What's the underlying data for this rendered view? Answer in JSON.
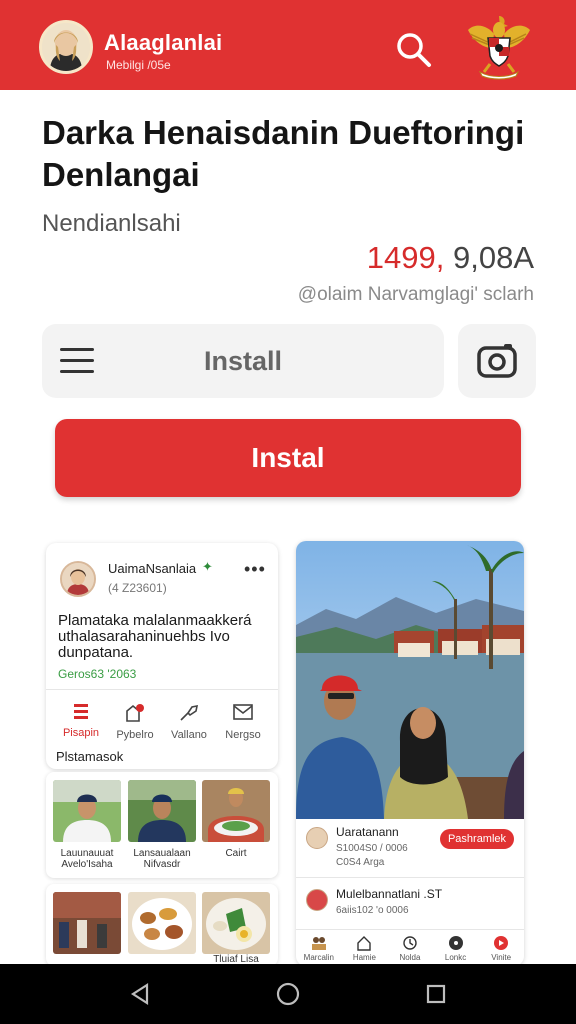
{
  "appbar": {
    "title": "Alaaglanlai",
    "subtitle": "Mebilgi /05e",
    "avatar_icon": "profile-avatar",
    "search_icon": "search-icon",
    "emblem_icon": "garuda-emblem",
    "color": "#e03232"
  },
  "headline": {
    "title": "Darka Henaisdanin Dueftoringi Denlangai",
    "subtitle": "Nendianlsahi",
    "price_accent": "1499,",
    "price_rest": " 9,08A",
    "claim": "@olaim Narvamglagi' sclarh"
  },
  "secondary": {
    "menu_icon": "hamburger-menu-icon",
    "install_label": "Install",
    "camera_icon": "camera-icon"
  },
  "primary_button": {
    "label": "Instal",
    "color": "#e03232"
  },
  "post_card": {
    "author": "UaimaNsanlaia",
    "verified_mark": "✦",
    "meta": "(4 Z23601)",
    "menu": "•••",
    "body": "Plamataka malalanmaakkerá uthalasarahaninuehbs Ivo dunpatana.",
    "tag": "Geros63 '2063",
    "actions": [
      {
        "label": "Pisapin",
        "icon": "bookmark-icon",
        "active": true
      },
      {
        "label": "Pybelro",
        "icon": "edit-icon",
        "active": false
      },
      {
        "label": "Vallano",
        "icon": "share-icon",
        "active": false
      },
      {
        "label": "Nergso",
        "icon": "message-icon",
        "active": false
      }
    ],
    "section_label": "Plstamasok"
  },
  "thumb_row_1": {
    "captions": [
      "Lauunauuat Avelo'Isaha",
      "Lansaualaan Nifvasdr",
      "Cairt"
    ]
  },
  "thumb_row_2": {
    "captions": [
      "",
      "",
      "Tluiaf Lisa"
    ]
  },
  "photo_card": {
    "user1_name": "Uaratanann",
    "user1_meta": "S1004S0 / 0006",
    "user1_meta2": "C0S4 Arga",
    "chip": "Pashramlek",
    "user2_name": "Mulelbannatlani .ST",
    "user2_meta": "6aiis102 'o 0006",
    "mini_nav": [
      "Marcalin",
      "Hamie",
      "Nolda",
      "Lonkc",
      "Vinite"
    ]
  },
  "sysnav": {
    "back": "back-icon",
    "home": "home-icon",
    "recents": "recents-icon"
  }
}
